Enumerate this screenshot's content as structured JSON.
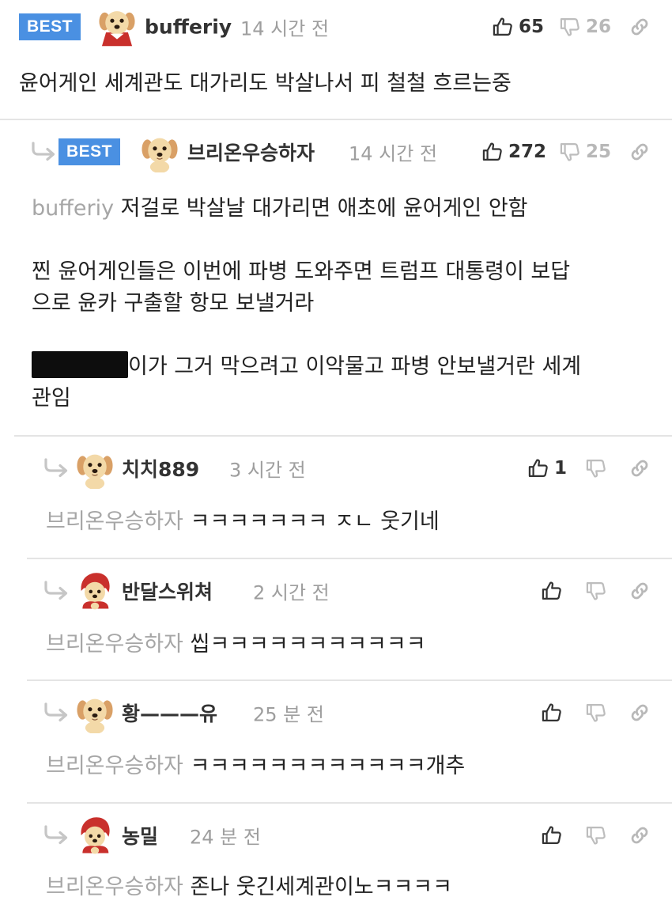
{
  "best_label": "BEST",
  "comments": [
    {
      "nickname": "bufferiy",
      "time": "14 시간 전",
      "upvotes": "65",
      "downvotes": "26",
      "avatar": "puppy-red-cape",
      "body": "윤어게인 세계관도 대가리도 박살나서 피 철철 흐르는중"
    },
    {
      "nickname": "브리온우승하자",
      "time": "14 시간 전",
      "upvotes": "272",
      "downvotes": "25",
      "avatar": "puppy",
      "mention": "bufferiy",
      "line1": "저걸로 박살날 대가리면 애초에 윤어게인 안함",
      "para2_line1": "찐 윤어게인들은 이번에 파병 도와주면 트럼프 대통령이 보답",
      "para2_line2": "으로 윤카 구출할 항모 보낼거라",
      "para3_line1": "이가 그거 막으려고 이악물고 파병 안보낼거란 세계",
      "para3_line2": "관임"
    },
    {
      "nickname": "치치889",
      "time": "3 시간 전",
      "upvotes": "1",
      "avatar": "puppy",
      "mention": "브리온우승하자",
      "text": "ㅋㅋㅋㅋㅋㅋㅋ ㅈㄴ 웃기네"
    },
    {
      "nickname": "반달스위쳐",
      "time": "2 시간 전",
      "avatar": "puppy-red-hood",
      "mention": "브리온우승하자",
      "text": "씹ㅋㅋㅋㅋㅋㅋㅋㅋㅋㅋㅋ"
    },
    {
      "nickname": "황———유",
      "time": "25 분 전",
      "avatar": "puppy-face",
      "mention": "브리온우승하자",
      "text": "ㅋㅋㅋㅋㅋㅋㅋㅋㅋㅋㅋㅋ개추"
    },
    {
      "nickname": "농밀",
      "time": "24 분 전",
      "avatar": "puppy-red-hood",
      "mention": "브리온우승하자",
      "text": "존나 웃긴세계관이노ㅋㅋㅋㅋ"
    }
  ],
  "icons": {
    "upvote": "thumbs-up-icon",
    "downvote": "thumbs-down-icon",
    "link": "link-icon",
    "reply": "reply-arrow-icon"
  },
  "colors": {
    "best_badge": "#4a90e2",
    "mention": "#a6a6a6",
    "time": "#9e9e9e",
    "divider": "#e4e4e4"
  }
}
